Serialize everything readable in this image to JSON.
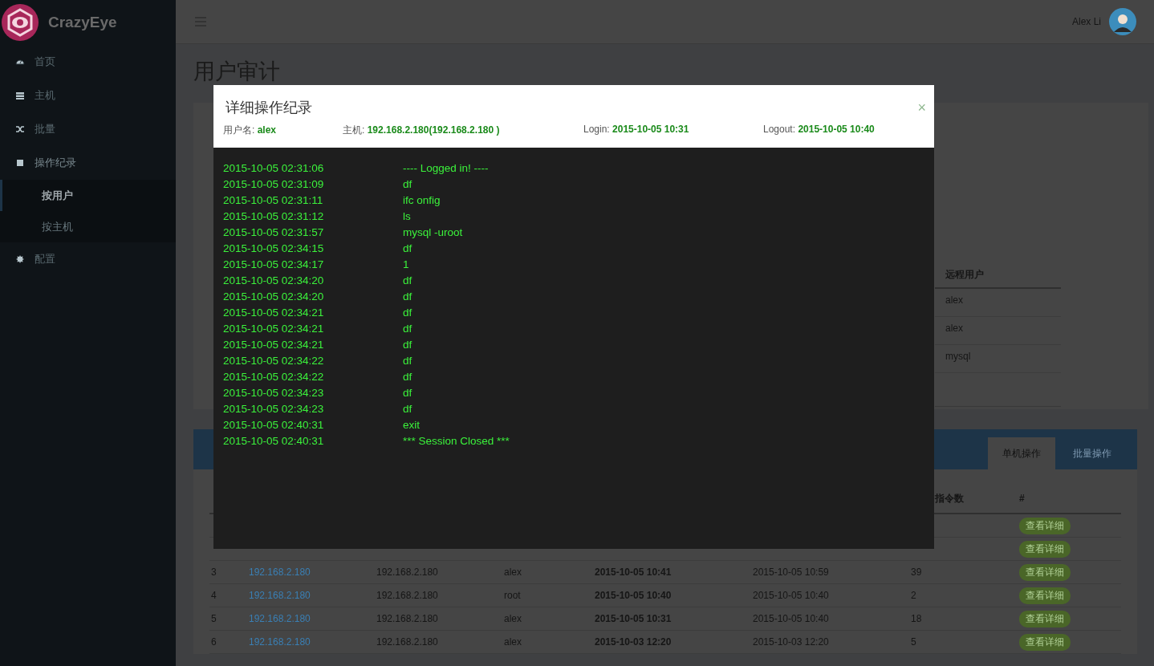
{
  "sidebar": {
    "brand": "CrazyEye",
    "items": [
      {
        "label": "首页",
        "expanded": false
      },
      {
        "label": "主机",
        "expanded": false
      },
      {
        "label": "批量",
        "expanded": false
      },
      {
        "label": "操作纪录",
        "expanded": true,
        "children": [
          {
            "label": "按用户",
            "selected": true
          },
          {
            "label": "按主机",
            "selected": false
          }
        ]
      },
      {
        "label": "配置",
        "expanded": false
      }
    ]
  },
  "topbar": {
    "user": "Alex Li"
  },
  "page_title": "用户审计",
  "remote_users": {
    "column": "远程用户",
    "rows": [
      "alex",
      "alex",
      "mysql"
    ]
  },
  "sessions": {
    "tabs": [
      {
        "label": "单机操作",
        "selected": true
      },
      {
        "label": "批量操作",
        "selected": false
      }
    ],
    "columns": [
      "",
      "",
      "",
      "",
      "",
      "",
      "指令数",
      "#"
    ],
    "rows": [
      {
        "button": "查看详细"
      },
      {
        "button": "查看详细"
      },
      {
        "cells": [
          "3",
          "192.168.2.180",
          "192.168.2.180",
          "alex",
          "2015-10-05 10:41",
          "2015-10-05 10:59",
          "39"
        ],
        "button": "查看详细"
      },
      {
        "cells": [
          "4",
          "192.168.2.180",
          "192.168.2.180",
          "root",
          "2015-10-05 10:40",
          "2015-10-05 10:40",
          "2"
        ],
        "button": "查看详细"
      },
      {
        "cells": [
          "5",
          "192.168.2.180",
          "192.168.2.180",
          "alex",
          "2015-10-05 10:31",
          "2015-10-05 10:40",
          "18"
        ],
        "button": "查看详细"
      },
      {
        "cells": [
          "6",
          "192.168.2.180",
          "192.168.2.180",
          "alex",
          "2015-10-03 12:20",
          "2015-10-03 12:20",
          "5"
        ],
        "button": "查看详细"
      }
    ]
  },
  "modal": {
    "title": "详细操作纪录",
    "close": "×",
    "meta": [
      {
        "label": "用户名:",
        "value": "alex"
      },
      {
        "label": "主机:",
        "value": "192.168.2.180(192.168.2.180 )"
      },
      {
        "label": "Login:",
        "value": "2015-10-05 10:31"
      },
      {
        "label": "Logout:",
        "value": "2015-10-05 10:40"
      }
    ],
    "log": [
      {
        "time": "2015-10-05 02:31:06",
        "command": "---- Logged in! ----"
      },
      {
        "time": "2015-10-05 02:31:09",
        "command": "df"
      },
      {
        "time": "2015-10-05 02:31:11",
        "command": "ifc onfig"
      },
      {
        "time": "2015-10-05 02:31:12",
        "command": "ls"
      },
      {
        "time": "2015-10-05 02:31:57",
        "command": "mysql -uroot"
      },
      {
        "time": "2015-10-05 02:34:15",
        "command": "df"
      },
      {
        "time": "2015-10-05 02:34:17",
        "command": "1"
      },
      {
        "time": "2015-10-05 02:34:20",
        "command": "df"
      },
      {
        "time": "2015-10-05 02:34:20",
        "command": "df"
      },
      {
        "time": "2015-10-05 02:34:21",
        "command": "df"
      },
      {
        "time": "2015-10-05 02:34:21",
        "command": "df"
      },
      {
        "time": "2015-10-05 02:34:21",
        "command": "df"
      },
      {
        "time": "2015-10-05 02:34:22",
        "command": "df"
      },
      {
        "time": "2015-10-05 02:34:22",
        "command": "df"
      },
      {
        "time": "2015-10-05 02:34:23",
        "command": "df"
      },
      {
        "time": "2015-10-05 02:34:23",
        "command": "df"
      },
      {
        "time": "2015-10-05 02:40:31",
        "command": "exit"
      },
      {
        "time": "2015-10-05 02:40:31",
        "command": "*** Session Closed ***"
      }
    ]
  }
}
